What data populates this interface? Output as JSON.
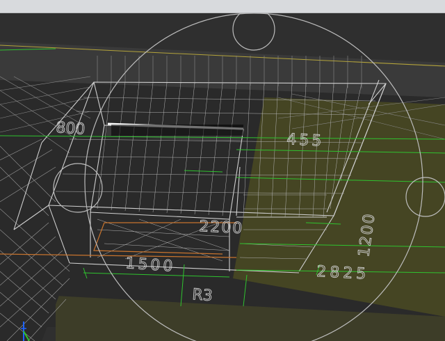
{
  "window": {
    "title": ""
  },
  "viewport": {
    "colors": {
      "background": "#2f2f2f",
      "wireframe": "#cfcfcf",
      "highlight_edge": "#ffffff",
      "dimension_green": "#2fc42f",
      "yellow_face": "#4a4a22",
      "orbit_circle": "#bdbdbd",
      "orange_line": "#c8742e",
      "axis_blue": "#1e63ff"
    },
    "dimensions": {
      "dim_800": "800",
      "dim_455": "455",
      "dim_2200": "2200",
      "dim_1500": "1500",
      "dim_1200": "1200",
      "dim_2825": "2825",
      "dim_r3": "R3"
    },
    "icons": {
      "orbit": "orbit-circle-icon",
      "axis": "axis-triad-icon"
    }
  }
}
